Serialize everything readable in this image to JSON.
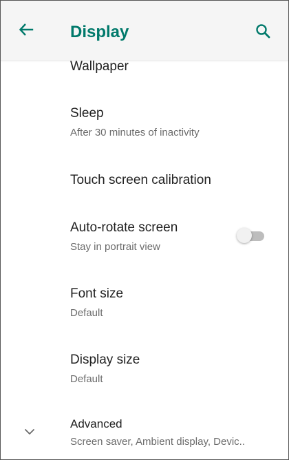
{
  "header": {
    "back_icon": "arrow-left-icon",
    "title": "Display",
    "search_icon": "search-icon"
  },
  "colors": {
    "accent": "#00796b",
    "appbar_bg": "#f5f5f5",
    "primary_text": "#212121",
    "secondary_text": "#6b6b6b",
    "toggle_track_off": "#bdbdbd"
  },
  "settings": {
    "wallpaper": {
      "label": "Wallpaper"
    },
    "sleep": {
      "label": "Sleep",
      "summary": "After 30 minutes of inactivity"
    },
    "touch_calibration": {
      "label": "Touch screen calibration"
    },
    "auto_rotate": {
      "label": "Auto-rotate screen",
      "summary": "Stay in portrait view",
      "enabled": false
    },
    "font_size": {
      "label": "Font size",
      "summary": "Default"
    },
    "display_size": {
      "label": "Display size",
      "summary": "Default"
    },
    "advanced": {
      "label": "Advanced",
      "summary": "Screen saver, Ambient display, Devic..",
      "icon": "chevron-down-icon"
    }
  }
}
